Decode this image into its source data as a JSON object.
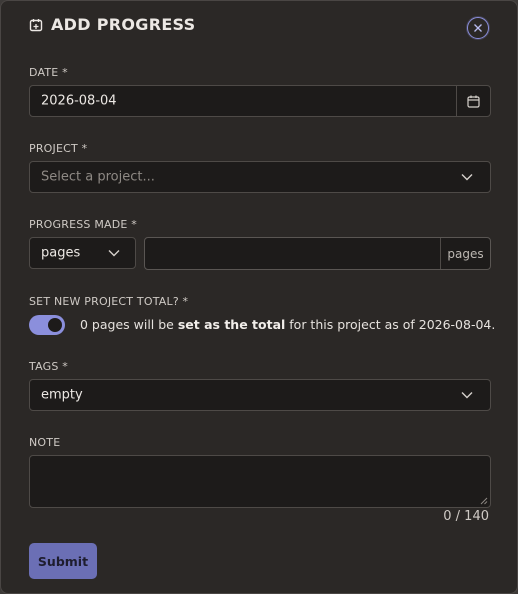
{
  "dialog": {
    "title": "ADD PROGRESS",
    "icons": {
      "title": "calendar-plus-icon",
      "close": "close-circle-icon"
    }
  },
  "form": {
    "date": {
      "label": "DATE *",
      "value": "2026-08-04",
      "icon": "calendar-icon"
    },
    "project": {
      "label": "PROJECT *",
      "placeholder": "Select a project..."
    },
    "progress": {
      "label": "PROGRESS MADE *",
      "unit_select_value": "pages",
      "amount_value": "",
      "unit_suffix": "pages"
    },
    "set_total": {
      "label": "SET NEW PROJECT TOTAL? *",
      "enabled": true,
      "text_before": "0 pages will be ",
      "text_bold": "set as the total",
      "text_after": " for this project as of 2026-08-04."
    },
    "tags": {
      "label": "TAGS *",
      "value": "empty"
    },
    "note": {
      "label": "NOTE",
      "value": "",
      "counter": "0 / 140"
    },
    "submit_label": "Submit"
  },
  "colors": {
    "background": "#2b2826",
    "field_background": "#1d1b1a",
    "accent": "#8b8fdc",
    "submit": "#6b6fb5"
  }
}
